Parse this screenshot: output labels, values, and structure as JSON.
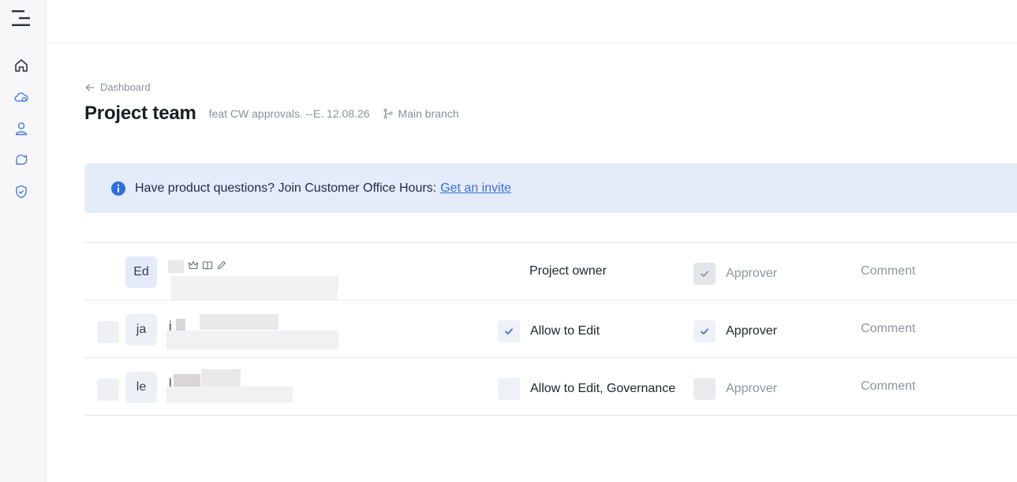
{
  "sidebar": {
    "nav": [
      {
        "icon": "home-icon"
      },
      {
        "icon": "cloud-settings-icon"
      },
      {
        "icon": "user-icon"
      },
      {
        "icon": "puzzle-icon"
      },
      {
        "icon": "shield-check-icon"
      }
    ]
  },
  "breadcrumb": {
    "label": "Dashboard"
  },
  "header": {
    "title": "Project team",
    "branch": "feat CW approvals. --E. 12.08.26",
    "main_branch": "Main branch"
  },
  "banner": {
    "text": "Have product questions? Join Customer Office Hours:",
    "link": "Get an invite"
  },
  "members": [
    {
      "initials": "Ed",
      "role": "Project owner",
      "approver": "Approver",
      "approver_state": "checked-disabled",
      "comment": "Comment"
    },
    {
      "initials": "ja",
      "name_initial": "j",
      "permission": "Allow to Edit",
      "permission_checked": true,
      "approver": "Approver",
      "approver_state": "checked",
      "comment": "Comment"
    },
    {
      "initials": "le",
      "name_initial": "l",
      "permission": "Allow to Edit, Governance",
      "permission_checked": false,
      "approver": "Approver",
      "approver_state": "unchecked-disabled",
      "comment": "Comment"
    }
  ],
  "colors": {
    "accent": "#3b6fd8",
    "banner_bg": "#e4ecfa",
    "muted_text": "#8f959c"
  }
}
